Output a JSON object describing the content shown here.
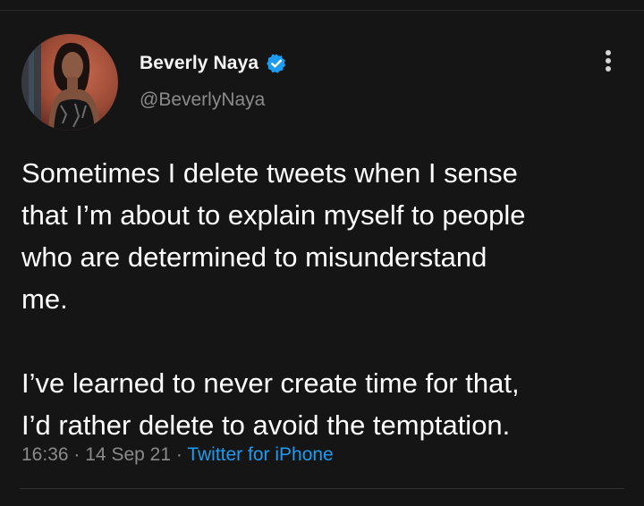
{
  "tweet": {
    "author": {
      "display_name": "Beverly Naya",
      "handle": "@BeverlyNaya",
      "verified": true,
      "avatar_icon": "profile-photo"
    },
    "text": "Sometimes I delete tweets when I sense\nthat I’m about to explain myself to people\nwho are determined to misunderstand\nme.\n\nI’ve learned to never create time for that,\nI’d rather delete to avoid the temptation.",
    "time": "16:36",
    "date": "14 Sep 21",
    "separator": "·",
    "source": "Twitter for iPhone",
    "menu_icon": "more-vertical-icon"
  },
  "colors": {
    "background": "#151515",
    "text": "#ffffff",
    "muted": "#8b8b8b",
    "link": "#1d9bf0",
    "verified_badge": "#1d9bf0"
  }
}
